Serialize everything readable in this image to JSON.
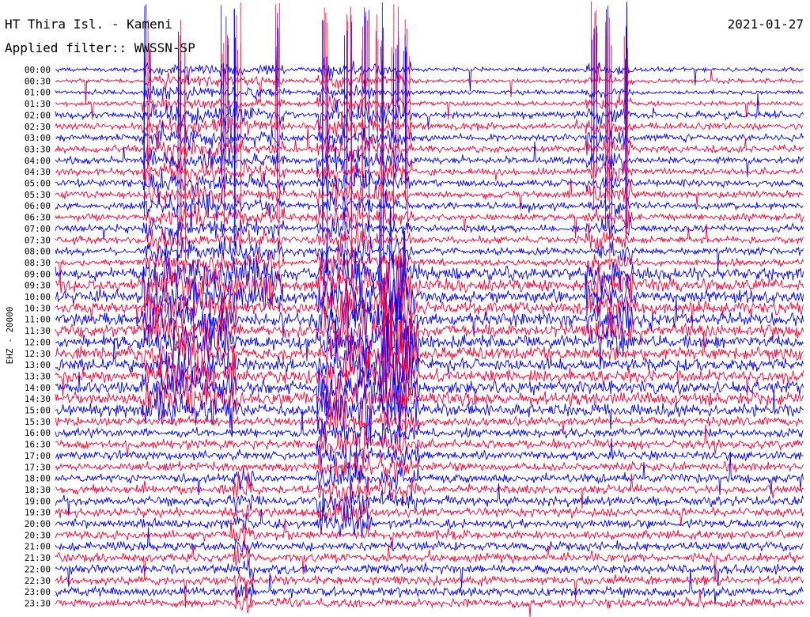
{
  "header": {
    "station": "HT Thira Isl. - Kameni",
    "date": "2021-01-27",
    "filter": "Applied filter:: WWSSN-SP"
  },
  "chart_data": {
    "type": "line",
    "title": "HT Thira Isl. - Kameni",
    "subtitle": "Applied filter:: WWSSN-SP",
    "date": "2021-01-27",
    "ylabel": "EHZ - 20000",
    "time_labels": [
      "00:00",
      "00:30",
      "01:00",
      "01:30",
      "02:00",
      "02:30",
      "03:00",
      "03:30",
      "04:00",
      "04:30",
      "05:00",
      "05:30",
      "06:00",
      "06:30",
      "07:00",
      "07:30",
      "08:00",
      "08:30",
      "09:00",
      "09:30",
      "10:00",
      "10:30",
      "11:00",
      "11:30",
      "12:00",
      "12:30",
      "13:00",
      "13:30",
      "14:00",
      "14:30",
      "15:00",
      "15:30",
      "16:00",
      "16:30",
      "17:00",
      "17:30",
      "18:00",
      "18:30",
      "19:00",
      "19:30",
      "20:00",
      "20:30",
      "21:00",
      "21:30",
      "22:00",
      "22:30",
      "23:00",
      "23:30"
    ],
    "series_colors": [
      "#0000ff",
      "#ff0033"
    ],
    "traces_per_hour_alternating": true
  }
}
